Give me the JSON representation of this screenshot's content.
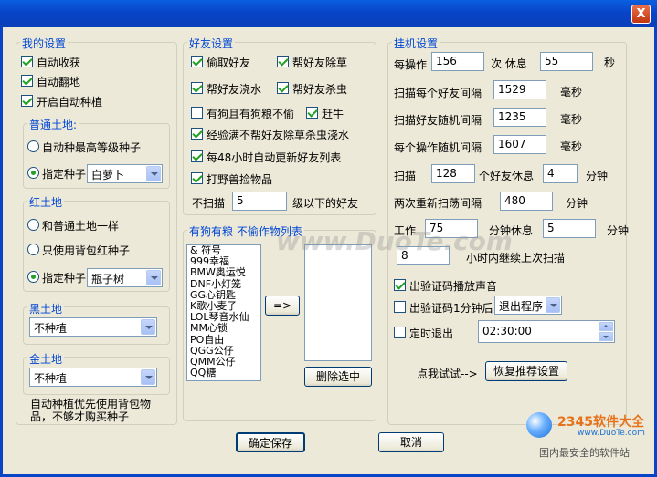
{
  "window": {
    "close_label": "X"
  },
  "my_settings": {
    "title": "我的设置",
    "auto_harvest": "自动收获",
    "auto_plow": "自动翻地",
    "auto_plant": "开启自动种植",
    "normal_land": {
      "title": "普通土地:",
      "option_highest": "自动种最高等级种子",
      "option_specify": "指定种子",
      "seed": "白萝卜"
    },
    "red_land": {
      "title": "红土地",
      "option_same": "和普通土地一样",
      "option_bag": "只使用背包红种子",
      "option_specify": "指定种子",
      "seed": "瓶子树"
    },
    "black_land": {
      "title": "黑土地",
      "value": "不种植"
    },
    "gold_land": {
      "title": "金土地",
      "value": "不种植"
    },
    "note": "自动种植优先使用背包物品，不够才购买种子"
  },
  "friend_settings": {
    "title": "好友设置",
    "steal": "偷取好友",
    "help_weed": "帮好友除草",
    "help_water": "帮好友浇水",
    "help_bug": "帮好友杀虫",
    "dog_no_food": "有狗且有狗粮不偷",
    "chase_cow": "赶牛",
    "exp_full": "经验满不帮好友除草杀虫浇水",
    "refresh": "每48小时自动更新好友列表",
    "pickup": "打野兽捡物品",
    "skip_label": "不扫描",
    "skip_value": "5",
    "skip_suffix": "级以下的好友"
  },
  "dog_list": {
    "title": "有狗有粮 不偷作物列表",
    "items": [
      "& 符号",
      "999幸福",
      "BMW奥运悦",
      "DNF小灯笼",
      "GG心钥匙",
      "K歌小麦子",
      "LOL琴音水仙",
      "MM心锁",
      "PO自由",
      "QGG公仔",
      "QMM公仔",
      "QQ糖"
    ],
    "move_label": "=>",
    "delete_label": "删除选中"
  },
  "idle_settings": {
    "title": "挂机设置",
    "per_op_label": "每操作",
    "per_op_value": "156",
    "rest_label": "次 休息",
    "rest_value": "55",
    "sec": "秒",
    "friend_interval_label": "扫描每个好友间隔",
    "friend_interval_value": "1529",
    "random_interval_label": "扫描好友随机间隔",
    "random_interval_value": "1235",
    "op_random_label": "每个操作随机间隔",
    "op_random_value": "1607",
    "ms": "毫秒",
    "scan_label": "扫描",
    "scan_value": "128",
    "scan_rest_label": "个好友休息",
    "scan_rest_value": "4",
    "minute": "分钟",
    "rescan_label": "两次重新扫荡间隔",
    "rescan_value": "480",
    "work_label": "工作",
    "work_value": "75",
    "work_rest_label": "分钟休息",
    "work_rest_value": "5",
    "continue_value": "8",
    "continue_label": "小时内继续上次扫描",
    "captcha_sound": "出验证码播放声音",
    "captcha_after": "出验证码1分钟后",
    "captcha_action": "退出程序",
    "timed_exit": "定时退出",
    "exit_time": "02:30:00",
    "try_label": "点我试试-->",
    "restore_label": "恢复推荐设置"
  },
  "footer": {
    "ok_label": "确定保存",
    "cancel_label": "取消"
  },
  "watermark": {
    "text": "www.DuoTe.com"
  },
  "logo": {
    "brand": "2345软件大全",
    "url": "www.DuoTe.com",
    "slogan": "国内最安全的软件站"
  }
}
